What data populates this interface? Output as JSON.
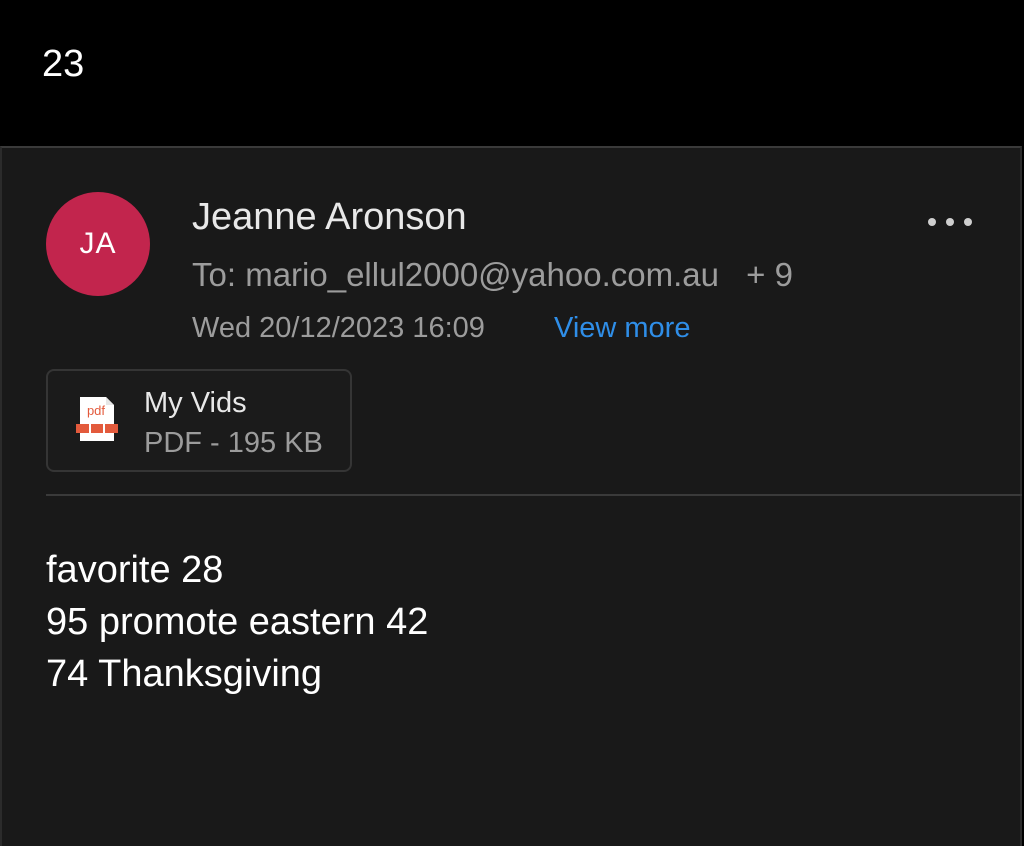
{
  "header": {
    "counter": "23"
  },
  "message": {
    "avatar_initials": "JA",
    "avatar_color": "#c2254d",
    "sender_name": "Jeanne Aronson",
    "to_label": "To:",
    "to_address": "mario_ellul2000@yahoo.com.au",
    "extra_recipients": "+ 9",
    "date": "Wed 20/12/2023 16:09",
    "view_more_label": "View more",
    "more_options_icon": "more-horizontal-icon"
  },
  "attachment": {
    "icon": "pdf-file-icon",
    "icon_label": "pdf",
    "name": "My Vids",
    "meta": "PDF - 195 KB"
  },
  "body": {
    "lines": [
      "favorite 28",
      "95 promote eastern 42",
      "74 Thanksgiving"
    ]
  },
  "colors": {
    "accent_link": "#2f8ee8",
    "pdf_icon": "#e35a3c"
  }
}
